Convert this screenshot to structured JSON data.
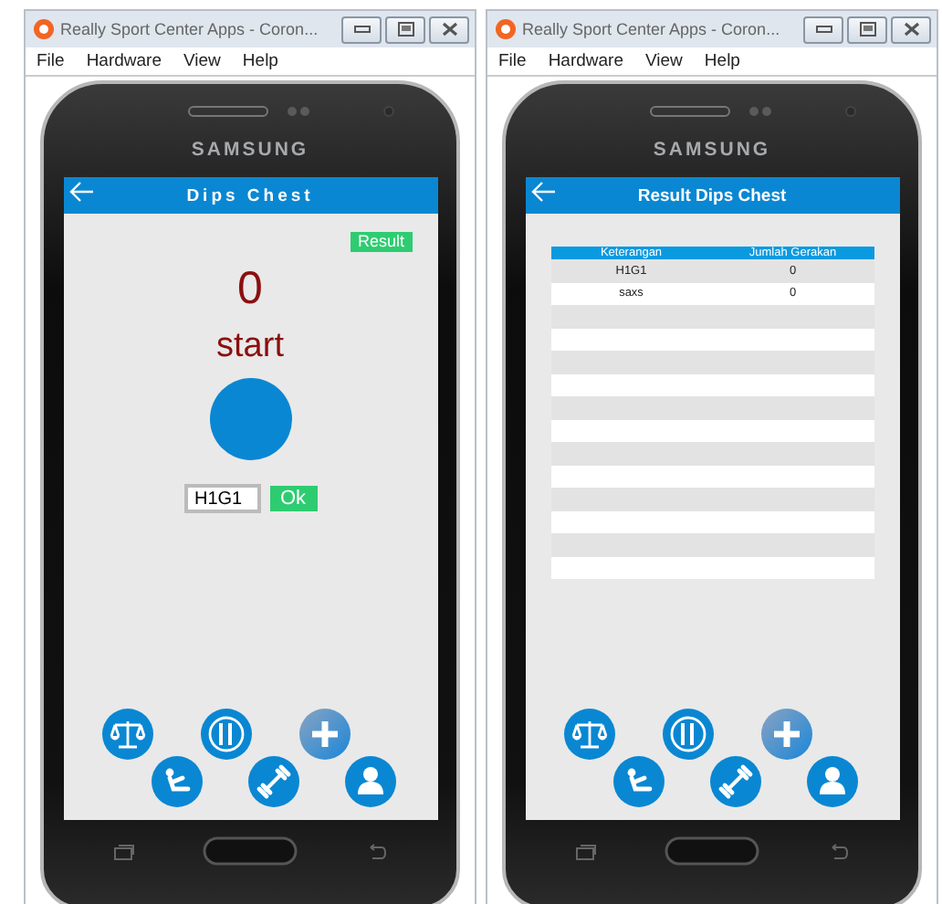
{
  "windows": [
    {
      "title": "Really Sport Center Apps - Coron...",
      "menu": [
        "File",
        "Hardware",
        "View",
        "Help"
      ],
      "brand": "SAMSUNG",
      "screen": {
        "kind": "counter",
        "header": "Dips Chest",
        "result_button": "Result",
        "count": "0",
        "status": "start",
        "input": {
          "value": "H1G1"
        },
        "ok_button": "Ok"
      }
    },
    {
      "title": "Really Sport Center Apps - Coron...",
      "menu": [
        "File",
        "Hardware",
        "View",
        "Help"
      ],
      "brand": "SAMSUNG",
      "screen": {
        "kind": "results",
        "header": "Result Dips Chest",
        "table": {
          "columns": [
            "Keterangan",
            "Jumlah Gerakan"
          ],
          "rows": [
            [
              "H1G1",
              "0"
            ],
            [
              "saxs",
              "0"
            ]
          ]
        }
      }
    }
  ]
}
